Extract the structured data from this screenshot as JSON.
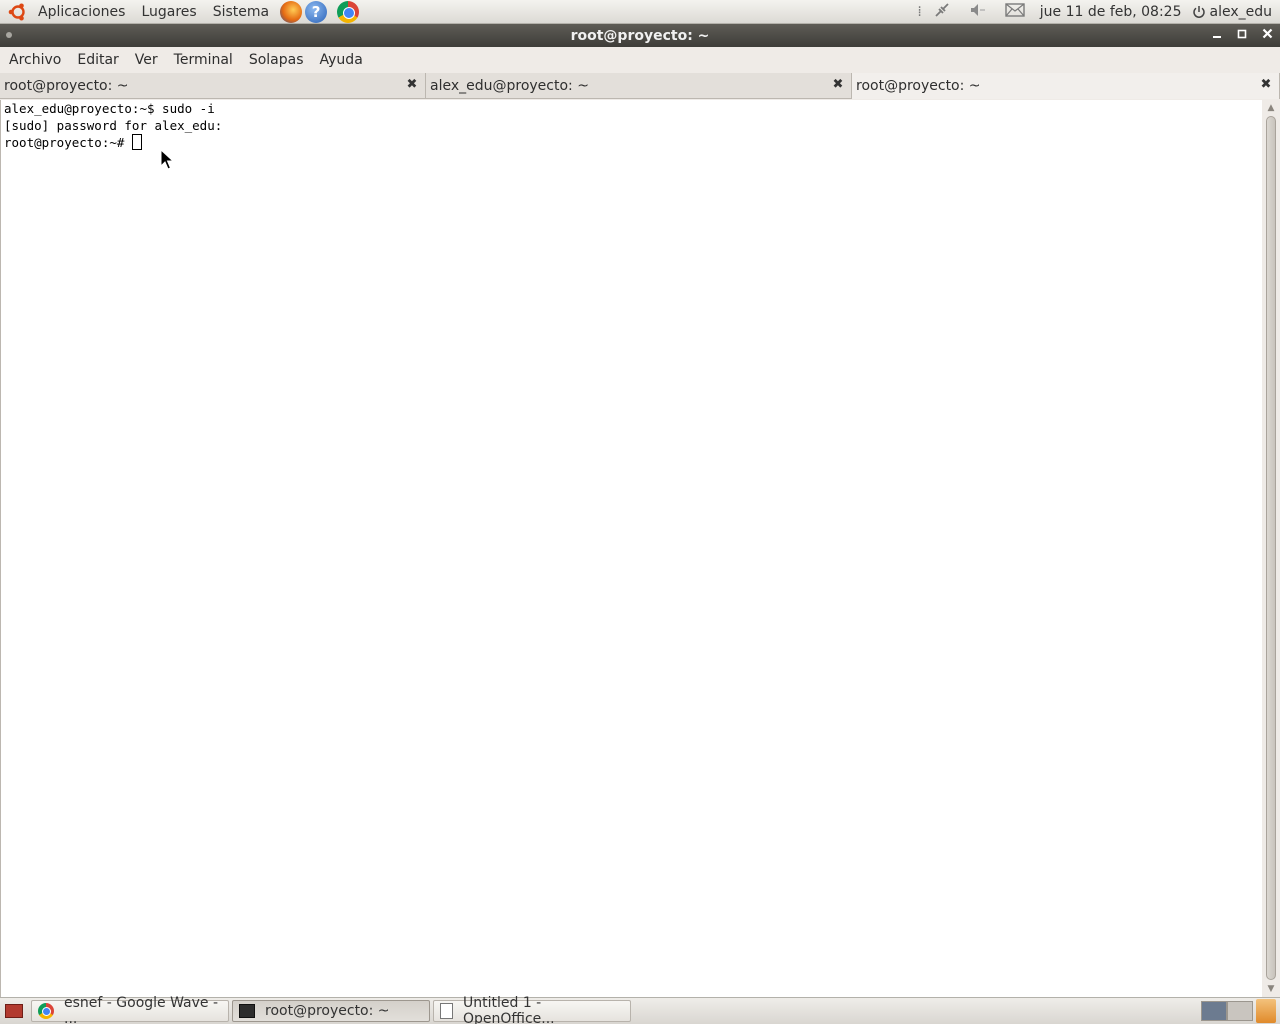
{
  "top_panel": {
    "menus": [
      "Aplicaciones",
      "Lugares",
      "Sistema"
    ],
    "launchers": [
      "firefox-icon",
      "help-icon",
      "chrome-icon"
    ],
    "help_glyph": "?",
    "clock": "jue 11 de feb, 08:25",
    "user": "alex_edu"
  },
  "window": {
    "title": "root@proyecto: ~",
    "menubar": [
      "Archivo",
      "Editar",
      "Ver",
      "Terminal",
      "Solapas",
      "Ayuda"
    ],
    "tabs": [
      {
        "label": "root@proyecto: ~",
        "active": false
      },
      {
        "label": "alex_edu@proyecto: ~",
        "active": false
      },
      {
        "label": "root@proyecto: ~",
        "active": true
      }
    ]
  },
  "terminal": {
    "lines": [
      "alex_edu@proyecto:~$ sudo -i",
      "[sudo] password for alex_edu:",
      "root@proyecto:~# "
    ]
  },
  "taskbar": {
    "tasks": [
      {
        "label": "esnef - Google Wave - ...",
        "icon": "chrome-icon",
        "active": false
      },
      {
        "label": "root@proyecto: ~",
        "icon": "terminal-icon",
        "active": true
      },
      {
        "label": "Untitled 1 - OpenOffice...",
        "icon": "document-icon",
        "active": false
      }
    ]
  },
  "colors": {
    "titlebar": "#4a4945",
    "panel": "#e6e4df",
    "terminal_bg": "#ffffff"
  }
}
